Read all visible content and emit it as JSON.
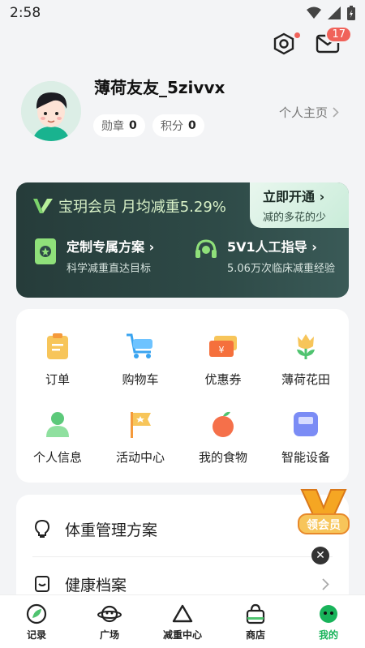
{
  "status": {
    "time": "2:58"
  },
  "header": {
    "message_count": "17"
  },
  "profile": {
    "username": "薄荷友友_5zivvx",
    "badge_label": "勋章",
    "badge_count": "0",
    "points_label": "积分",
    "points_count": "0",
    "homepage_link": "个人主页"
  },
  "vip": {
    "title": "宝玥会员 月均减重5.29%",
    "open_title": "立即开通",
    "open_subtitle": "减的多花的少",
    "features": [
      {
        "title": "定制专属方案",
        "subtitle": "科学减重直达目标"
      },
      {
        "title": "5V1人工指导",
        "subtitle": "5.06万次临床减重经验"
      }
    ]
  },
  "grid": [
    {
      "label": "订单",
      "icon": "clipboard-icon"
    },
    {
      "label": "购物车",
      "icon": "cart-icon"
    },
    {
      "label": "优惠券",
      "icon": "coupon-icon"
    },
    {
      "label": "薄荷花田",
      "icon": "flower-icon"
    },
    {
      "label": "个人信息",
      "icon": "person-icon"
    },
    {
      "label": "活动中心",
      "icon": "flag-icon"
    },
    {
      "label": "我的食物",
      "icon": "apple-icon"
    },
    {
      "label": "智能设备",
      "icon": "scale-icon"
    }
  ],
  "list": [
    {
      "label": "体重管理方案"
    },
    {
      "label": "健康档案"
    }
  ],
  "float_vip": {
    "label": "领会员"
  },
  "tabs": [
    {
      "label": "记录"
    },
    {
      "label": "广场"
    },
    {
      "label": "减重中心"
    },
    {
      "label": "商店"
    },
    {
      "label": "我的"
    }
  ],
  "colors": {
    "accent": "#18b35a",
    "badge": "#f0625a",
    "vip_bg": "#2e4a47"
  }
}
